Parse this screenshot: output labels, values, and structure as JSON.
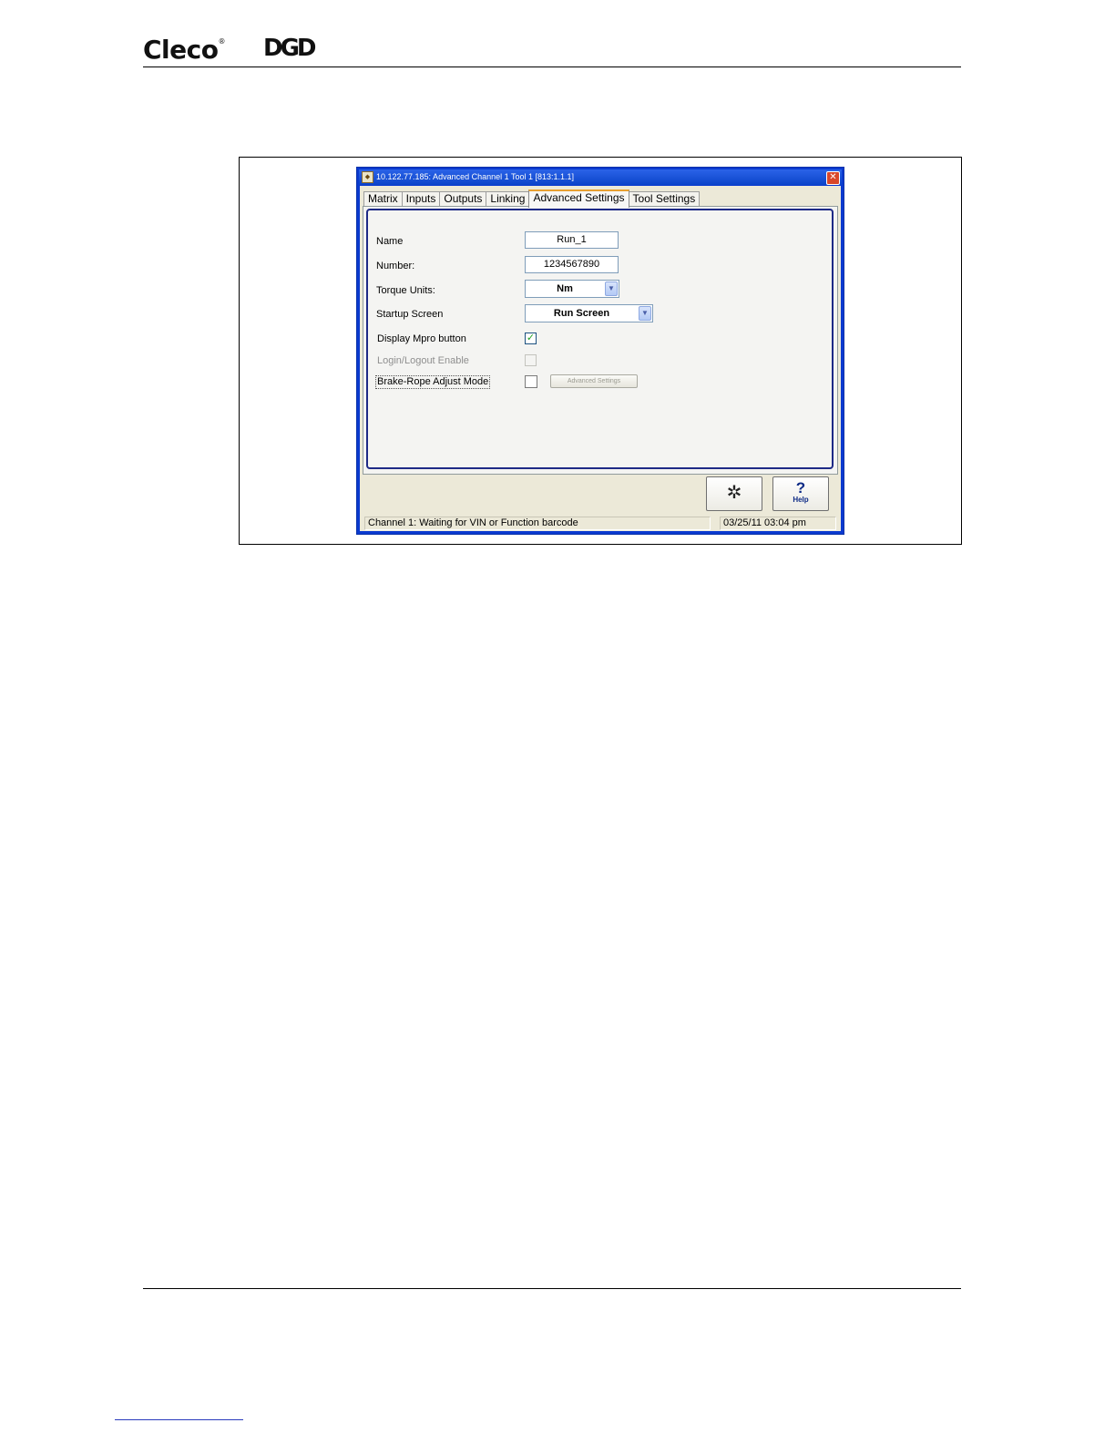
{
  "header": {
    "logo_cleco": "Cleco",
    "logo_cleco_mark": "®",
    "logo_dgd": "DGD"
  },
  "window": {
    "title": "10.122.77.185: Advanced  Channel 1  Tool 1 [813:1.1.1]",
    "close_glyph": "✕",
    "tabs": [
      {
        "label": "Matrix"
      },
      {
        "label": "Inputs"
      },
      {
        "label": "Outputs"
      },
      {
        "label": "Linking"
      },
      {
        "label": "Advanced Settings"
      },
      {
        "label": "Tool Settings"
      }
    ],
    "active_tab": "Advanced Settings",
    "form": {
      "name_label": "Name",
      "name_value": "Run_1",
      "number_label": "Number:",
      "number_value": "1234567890",
      "torque_units_label": "Torque Units:",
      "torque_units_value": "Nm",
      "startup_screen_label": "Startup Screen",
      "startup_screen_value": "Run Screen",
      "display_mpro_label": "Display Mpro button",
      "display_mpro_checked": true,
      "login_logout_label": "Login/Logout Enable",
      "login_logout_checked": false,
      "brake_rope_label": "Brake-Rope Adjust Mode",
      "brake_rope_checked": false,
      "advanced_settings_button": "Advanced Settings"
    },
    "buttons": {
      "config_glyph": "✲",
      "help_glyph": "?",
      "help_label": "Help"
    },
    "status": {
      "message": "Channel 1: Waiting for VIN or Function barcode",
      "datetime": "03/25/11 03:04 pm"
    },
    "colors": {
      "title_blue": "#0b44c9",
      "panel_border": "#1e2a86",
      "check_green": "#21a121"
    }
  }
}
